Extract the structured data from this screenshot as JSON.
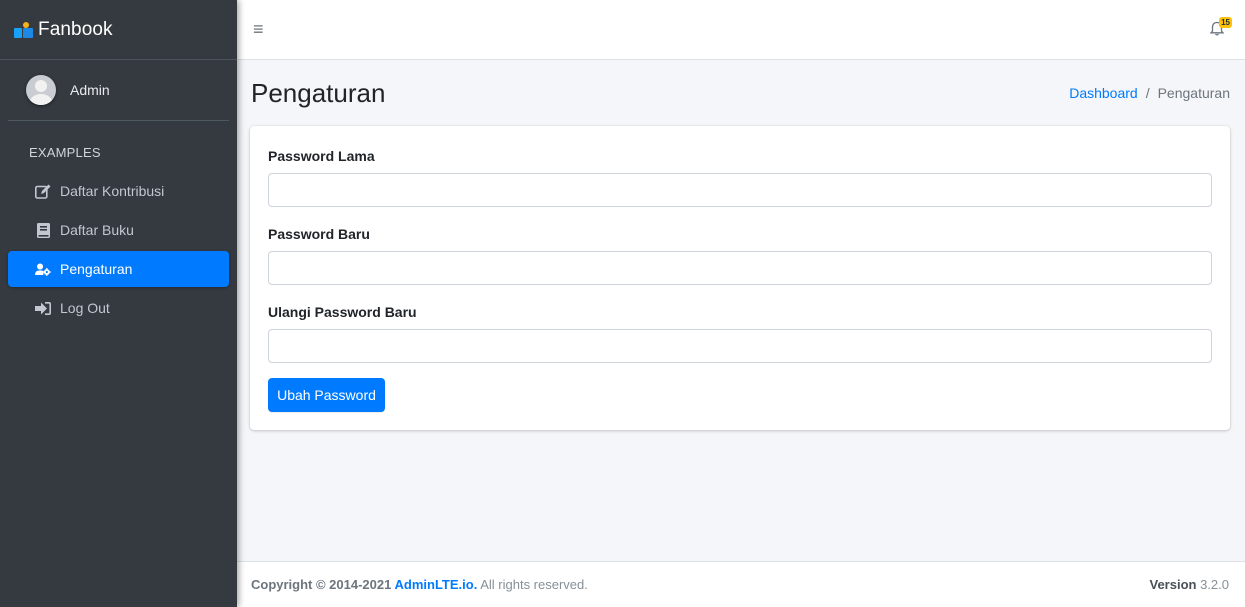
{
  "brand": {
    "name": "Fanbook"
  },
  "user": {
    "name": "Admin"
  },
  "sidebar": {
    "header": "EXAMPLES",
    "items": [
      {
        "label": "Daftar Kontribusi",
        "icon": "edit-icon",
        "active": false
      },
      {
        "label": "Daftar Buku",
        "icon": "book-icon",
        "active": false
      },
      {
        "label": "Pengaturan",
        "icon": "users-cog-icon",
        "active": true
      },
      {
        "label": "Log Out",
        "icon": "sign-out-icon",
        "active": false
      }
    ]
  },
  "navbar": {
    "menu_icon": "hamburger-icon",
    "notification_icon": "bell-icon",
    "notification_count": "15"
  },
  "page": {
    "title": "Pengaturan"
  },
  "breadcrumb": {
    "home": "Dashboard",
    "separator": "/",
    "current": "Pengaturan"
  },
  "form": {
    "old_password": {
      "label": "Password Lama",
      "value": "",
      "placeholder": ""
    },
    "new_password": {
      "label": "Password Baru",
      "value": "",
      "placeholder": ""
    },
    "repeat_password": {
      "label": "Ulangi Password Baru",
      "value": "",
      "placeholder": ""
    },
    "submit_label": "Ubah Password"
  },
  "footer": {
    "copyright_prefix": "Copyright © 2014-2021",
    "link_text": "AdminLTE.io.",
    "suffix": "All rights reserved.",
    "version_label": "Version",
    "version_value": "3.2.0"
  },
  "colors": {
    "primary": "#007bff",
    "sidebar_bg": "#343a40",
    "badge": "#ffc107"
  }
}
